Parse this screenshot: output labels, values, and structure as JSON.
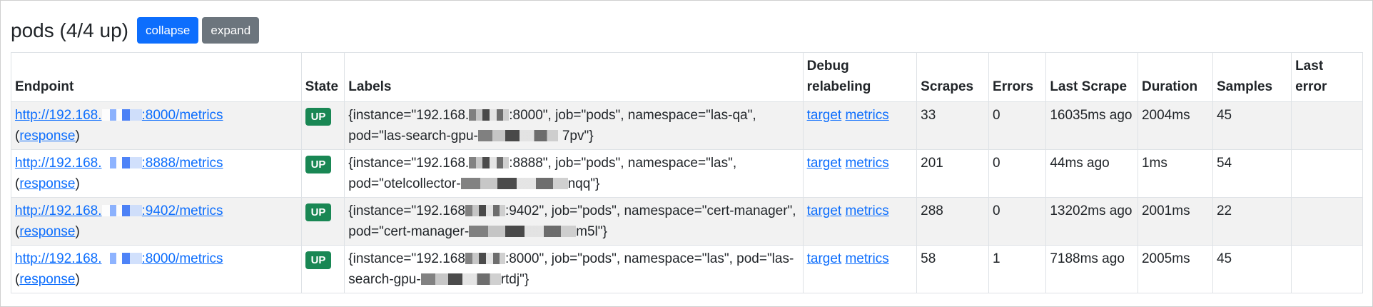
{
  "header": {
    "title": "pods (4/4 up)",
    "collapse_label": "collapse",
    "expand_label": "expand"
  },
  "columns": {
    "endpoint": "Endpoint",
    "state": "State",
    "labels": "Labels",
    "debug": "Debug relabeling",
    "scrapes": "Scrapes",
    "errors": "Errors",
    "last_scrape": "Last Scrape",
    "duration": "Duration",
    "samples": "Samples",
    "last_error": "Last error"
  },
  "rows": [
    {
      "endpoint_prefix": "http://192.168.",
      "endpoint_suffix": ":8000/metrics",
      "response_label": "response",
      "state": "UP",
      "labels_prefix": "{instance=\"192.168.",
      "labels_mid": ":8000\", job=\"pods\", namespace=\"las-qa\", pod=\"las-search-gpu-",
      "labels_suffix": "7pv\"}",
      "debug_target": "target",
      "debug_metrics": "metrics",
      "scrapes": "33",
      "errors": "0",
      "last_scrape": "16035ms ago",
      "duration": "2004ms",
      "samples": "45",
      "last_error": ""
    },
    {
      "endpoint_prefix": "http://192.168.",
      "endpoint_suffix": ":8888/metrics",
      "response_label": "response",
      "state": "UP",
      "labels_prefix": "{instance=\"192.168.",
      "labels_mid": ":8888\", job=\"pods\", namespace=\"las\", pod=\"otelcollector-",
      "labels_suffix": "nqq\"}",
      "debug_target": "target",
      "debug_metrics": "metrics",
      "scrapes": "201",
      "errors": "0",
      "last_scrape": "44ms ago",
      "duration": "1ms",
      "samples": "54",
      "last_error": ""
    },
    {
      "endpoint_prefix": "http://192.168.",
      "endpoint_suffix": ":9402/metrics",
      "response_label": "response",
      "state": "UP",
      "labels_prefix": "{instance=\"192.168",
      "labels_mid": ":9402\", job=\"pods\", namespace=\"cert-manager\", pod=\"cert-manager-",
      "labels_suffix": "m5l\"}",
      "debug_target": "target",
      "debug_metrics": "metrics",
      "scrapes": "288",
      "errors": "0",
      "last_scrape": "13202ms ago",
      "duration": "2001ms",
      "samples": "22",
      "last_error": ""
    },
    {
      "endpoint_prefix": "http://192.168.",
      "endpoint_suffix": ":8000/metrics",
      "response_label": "response",
      "state": "UP",
      "labels_prefix": "{instance=\"192.168",
      "labels_mid": ":8000\", job=\"pods\", namespace=\"las\", pod=\"las-search-gpu-",
      "labels_suffix": "rtdj\"}",
      "debug_target": "target",
      "debug_metrics": "metrics",
      "scrapes": "58",
      "errors": "1",
      "last_scrape": "7188ms ago",
      "duration": "2005ms",
      "samples": "45",
      "last_error": ""
    }
  ]
}
